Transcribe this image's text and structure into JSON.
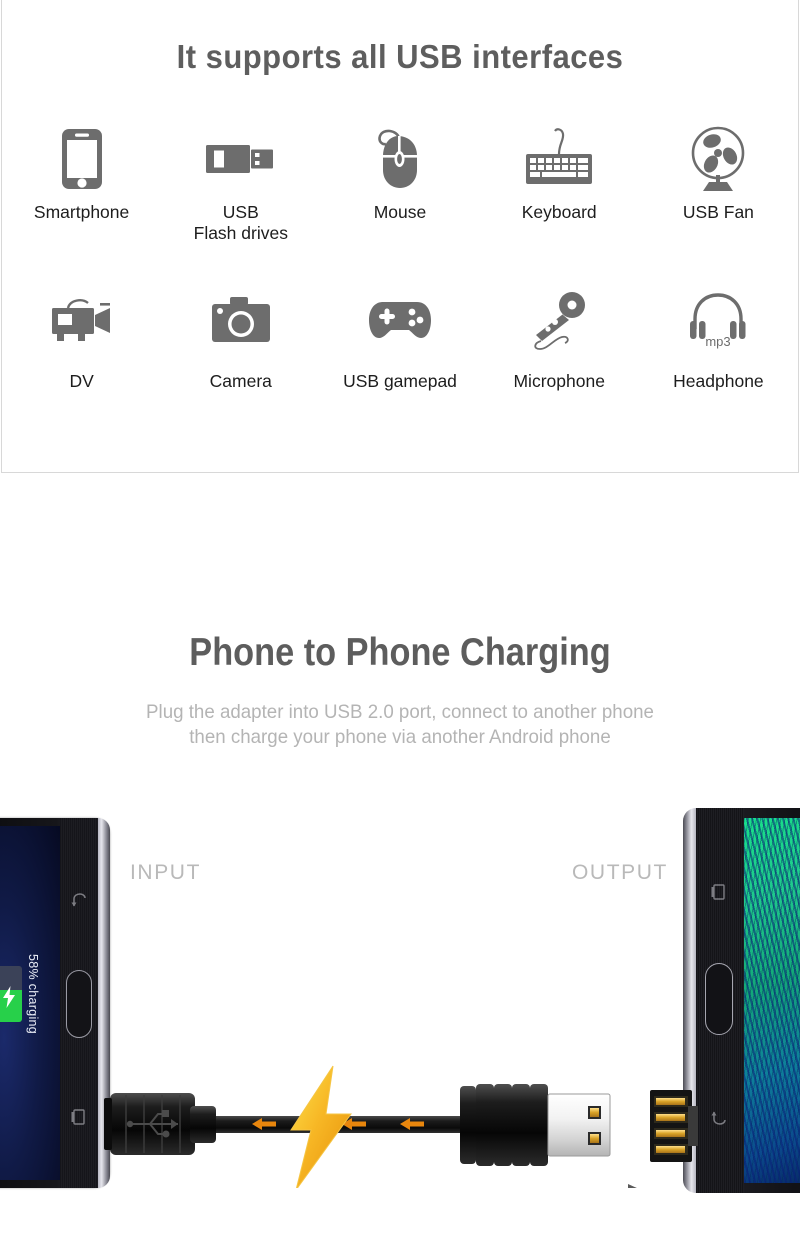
{
  "section1": {
    "title": "It supports all USB interfaces",
    "devices": [
      {
        "label": "Smartphone",
        "icon": "smartphone-icon"
      },
      {
        "label": "USB\nFlash drives",
        "icon": "usb-flash-drive-icon"
      },
      {
        "label": "Mouse",
        "icon": "mouse-icon"
      },
      {
        "label": "Keyboard",
        "icon": "keyboard-icon"
      },
      {
        "label": "USB Fan",
        "icon": "usb-fan-icon"
      },
      {
        "label": "DV",
        "icon": "camcorder-icon"
      },
      {
        "label": "Camera",
        "icon": "camera-icon"
      },
      {
        "label": "USB gamepad",
        "icon": "gamepad-icon"
      },
      {
        "label": "Microphone",
        "icon": "microphone-icon"
      },
      {
        "label": "Headphone",
        "icon": "headphone-icon"
      }
    ],
    "headphone_badge": "mp3",
    "icon_color": "#6d6d6d",
    "title_color": "#5e5e5e",
    "label_color": "#1d1d1d",
    "border_color": "#d8d8d8"
  },
  "section2": {
    "title": "Phone to Phone Charging",
    "subtitle": "Plug the adapter into USB 2.0 port, connect to another phone\nthen charge your phone via another Android phone",
    "input_label": "INPUT",
    "output_label": "OUTPUT",
    "title_color": "#5d5d5d",
    "subtitle_color": "#b4b4b4",
    "io_color": "#b9b9b9",
    "bolt_color": "#f5b324",
    "arrow_color": "#e8860d",
    "left_phone": {
      "battery_text": "58% charging",
      "battery_percent": 58,
      "battery_fill_color": "#27d04a",
      "screen_color": "#101a46"
    },
    "right_phone": {
      "screen_color": "#19e08a"
    }
  }
}
